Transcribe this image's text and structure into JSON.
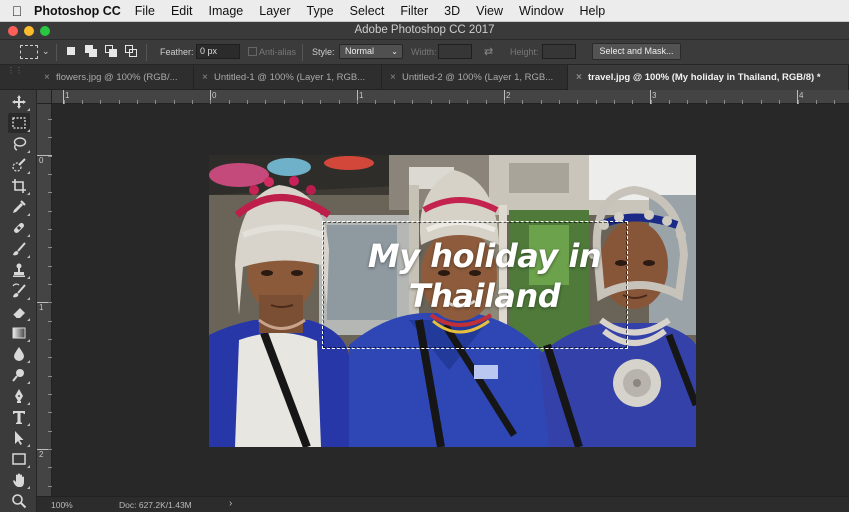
{
  "menubar": {
    "app_name": "Photoshop CC",
    "items": [
      "File",
      "Edit",
      "Image",
      "Layer",
      "Type",
      "Select",
      "Filter",
      "3D",
      "View",
      "Window",
      "Help"
    ]
  },
  "window": {
    "title": "Adobe Photoshop CC 2017"
  },
  "options": {
    "feather_label": "Feather:",
    "feather_value": "0 px",
    "antialias_label": "Anti-alias",
    "style_label": "Style:",
    "style_value": "Normal",
    "width_label": "Width:",
    "height_label": "Height:",
    "select_mask_label": "Select and Mask..."
  },
  "tabs": [
    {
      "label": "flowers.jpg @ 100% (RGB/...",
      "active": false
    },
    {
      "label": "Untitled-1 @ 100% (Layer 1, RGB...",
      "active": false
    },
    {
      "label": "Untitled-2 @ 100% (Layer 1, RGB...",
      "active": false
    },
    {
      "label": "travel.jpg @ 100% (My holiday in Thailand, RGB/8) *",
      "active": true
    }
  ],
  "ruler": {
    "horizontal": [
      "1",
      "0",
      "1",
      "2",
      "3",
      "4"
    ],
    "vertical": [
      "0",
      "1",
      "2"
    ]
  },
  "tools": [
    "move-tool",
    "rectangular-marquee-tool",
    "lasso-tool",
    "quick-selection-tool",
    "crop-tool",
    "eyedropper-tool",
    "spot-healing-brush-tool",
    "brush-tool",
    "clone-stamp-tool",
    "history-brush-tool",
    "eraser-tool",
    "gradient-tool",
    "blur-tool",
    "dodge-tool",
    "pen-tool",
    "type-tool",
    "path-selection-tool",
    "rectangle-tool",
    "hand-tool",
    "zoom-tool"
  ],
  "canvas": {
    "text_line1": "My holiday in",
    "text_line2": "Thailand"
  },
  "status": {
    "zoom": "100%",
    "doc_info": "Doc: 627.2K/1.43M",
    "arrow": "›"
  },
  "colors": {
    "close": "#fc5f57",
    "minimize": "#fdbc2e",
    "maximize": "#28c840",
    "panel": "#3b3b3b",
    "workspace": "#282828"
  }
}
